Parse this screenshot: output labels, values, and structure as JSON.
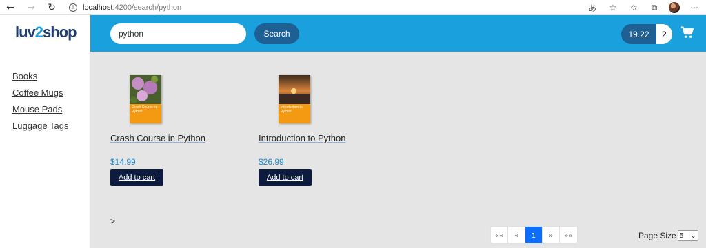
{
  "browser": {
    "url_host": "localhost",
    "url_path": ":4200/search/python"
  },
  "logo": {
    "part1": "luv",
    "part2": "2",
    "part3": "shop"
  },
  "sidebar": {
    "items": [
      {
        "label": "Books"
      },
      {
        "label": "Coffee Mugs"
      },
      {
        "label": "Mouse Pads"
      },
      {
        "label": "Luggage Tags"
      }
    ]
  },
  "header": {
    "search_value": "python",
    "search_button": "Search",
    "cart_total": "19.22",
    "cart_quantity": "2"
  },
  "products": [
    {
      "name": "Crash Course in Python",
      "price": "$14.99",
      "button": "Add to cart",
      "cover_title": "Crash Course in Python"
    },
    {
      "name": "Introduction to Python",
      "price": "$26.99",
      "button": "Add to cart",
      "cover_title": "Introduction to Python"
    }
  ],
  "pagination": {
    "first": "««",
    "prev": "«",
    "current": "1",
    "next": "»",
    "last": "»»",
    "expand": ">"
  },
  "page_size": {
    "label": "Page Size",
    "value": "5"
  },
  "colors": {
    "header_blue": "#1aa0dc",
    "dark_blue": "#1e5f94",
    "navy_button": "#0d1b3e",
    "price_blue": "#1a8ad0",
    "active_page": "#0d6efd"
  }
}
